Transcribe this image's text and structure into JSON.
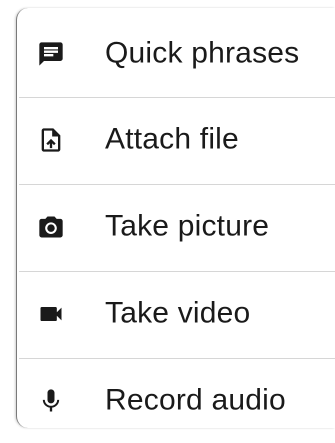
{
  "menu": {
    "items": [
      {
        "label": "Quick phrases",
        "icon": "message-icon"
      },
      {
        "label": "Attach file",
        "icon": "file-upload-icon"
      },
      {
        "label": "Take picture",
        "icon": "camera-icon"
      },
      {
        "label": "Take video",
        "icon": "videocam-icon"
      },
      {
        "label": "Record audio",
        "icon": "mic-icon"
      }
    ]
  },
  "colors": {
    "text": "#1a1a1a",
    "icon": "#1a1a1a",
    "divider": "#d6d6d6",
    "background": "#ffffff"
  }
}
